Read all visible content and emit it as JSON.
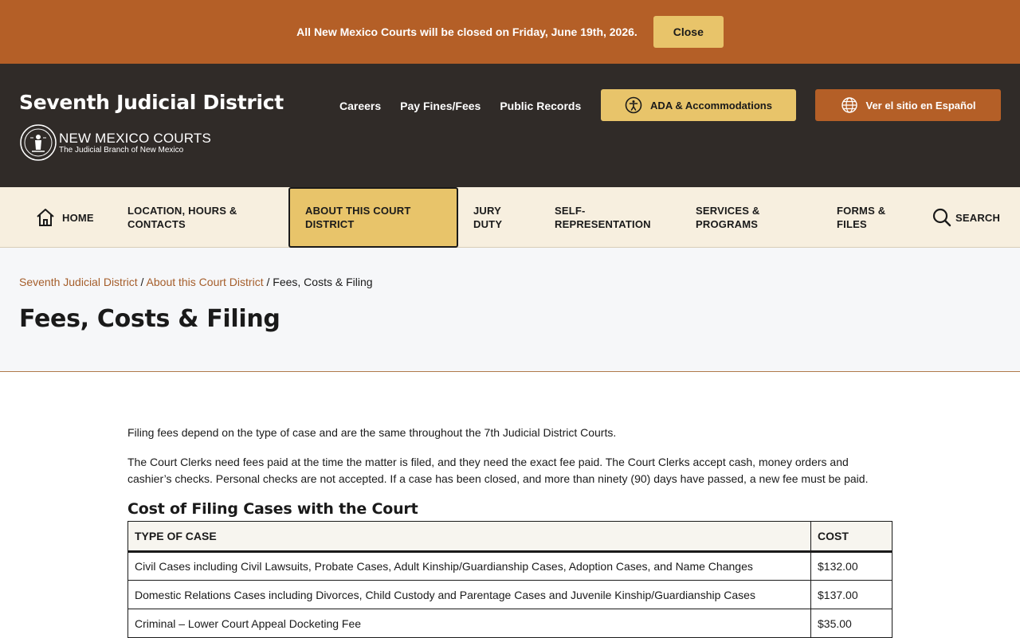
{
  "alert": {
    "message": "All New Mexico Courts will be closed on Friday, June 19th, 2026.",
    "close_label": "Close"
  },
  "header": {
    "site_title": "Seventh Judicial District",
    "logo_main": "NEW MEXICO COURTS",
    "logo_sub": "The Judicial Branch of New Mexico",
    "links": [
      "Careers",
      "Pay Fines/Fees",
      "Public Records"
    ],
    "ada_label": "ADA & Accommodations",
    "spanish_label": "Ver el sitio en Español"
  },
  "nav": {
    "home": "HOME",
    "location": "LOCATION, HOURS & CONTACTS",
    "about": "ABOUT THIS COURT DISTRICT",
    "jury": "JURY DUTY",
    "self_rep": "SELF-REPRESENTATION",
    "services": "SERVICES & PROGRAMS",
    "forms": "FORMS & FILES",
    "search": "SEARCH"
  },
  "breadcrumb": {
    "items": [
      "Seventh Judicial District",
      "About this Court District"
    ],
    "current": "Fees, Costs & Filing",
    "separator": "/"
  },
  "page_title": "Fees, Costs & Filing",
  "content": {
    "para1": "Filing fees depend on the type of case and are the same throughout the 7th Judicial District Courts.",
    "para2": "The Court Clerks need fees paid at the time the matter is filed, and they need the exact fee paid. The Court Clerks accept cash, money orders and cashier’s checks. Personal checks are not accepted. If a case has been closed, and more than ninety (90) days have passed, a new fee must be paid.",
    "section_title": "Cost of Filing Cases with the Court",
    "table": {
      "headers": [
        "TYPE OF CASE",
        "COST"
      ],
      "rows": [
        [
          "Civil Cases including Civil Lawsuits, Probate Cases, Adult Kinship/Guardianship Cases, Adoption Cases, and Name Changes",
          "$132.00"
        ],
        [
          "Domestic Relations Cases including Divorces, Child Custody and Parentage Cases and Juvenile Kinship/Guardianship Cases",
          "$137.00"
        ],
        [
          "Criminal – Lower Court Appeal Docketing Fee",
          "$35.00"
        ]
      ]
    }
  },
  "colors": {
    "alert_bg": "#b45f27",
    "header_bg": "#302b28",
    "accent_gold": "#e8c46a",
    "nav_bg": "#f7efdf",
    "link_color": "#a55e2b"
  }
}
